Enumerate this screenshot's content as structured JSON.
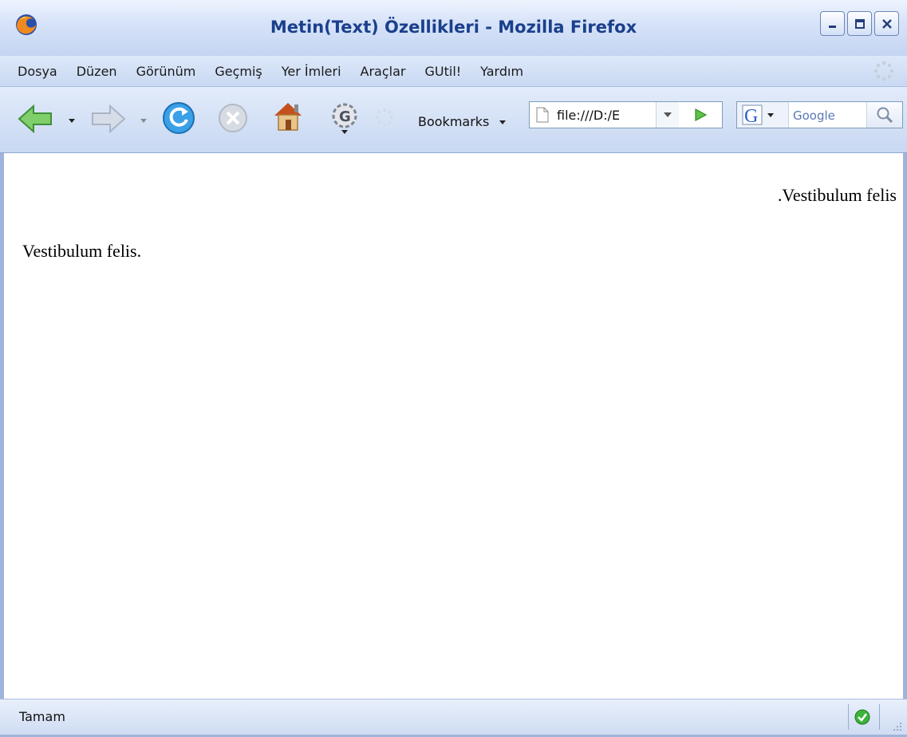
{
  "window": {
    "title": "Metin(Text) Özellikleri - Mozilla Firefox"
  },
  "menu": {
    "items": [
      "Dosya",
      "Düzen",
      "Görünüm",
      "Geçmiş",
      "Yer İmleri",
      "Araçlar",
      "GUtil!",
      "Yardım"
    ]
  },
  "toolbar": {
    "bookmarks_label": "Bookmarks",
    "url_value": "file:///D:/E",
    "search_placeholder": "Google",
    "icons": [
      "back-icon",
      "forward-icon",
      "reload-icon",
      "stop-icon",
      "home-icon",
      "gutil-icon",
      "spinner-icon"
    ]
  },
  "content": {
    "rtl_paragraph": ".Vestibulum felis",
    "ltr_paragraph": "Vestibulum felis."
  },
  "status": {
    "text": "Tamam"
  },
  "colors": {
    "title_text": "#1a3f8c",
    "chrome_blue": "#c8d8f2",
    "border": "#9fb4db"
  }
}
